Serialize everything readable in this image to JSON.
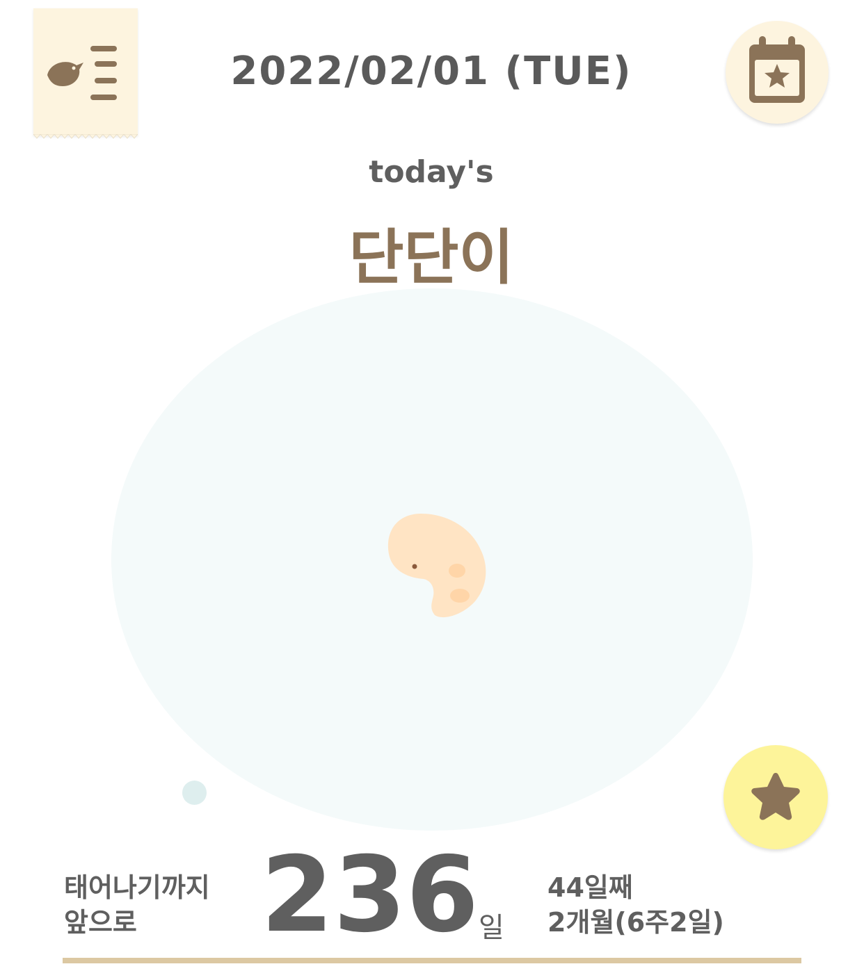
{
  "header": {
    "date": "2022/02/01 (TUE)"
  },
  "hero": {
    "todays_label": "today's",
    "baby_name": "단단이"
  },
  "countdown": {
    "label_line1": "태어나기까지",
    "label_line2": "앞으로",
    "days_left": "236",
    "unit": "일"
  },
  "pregnancy": {
    "day_count": "44일째",
    "month_week": "2개월(6주2일)"
  },
  "icons": {
    "menu": "bird-menu-icon",
    "calendar": "calendar-star-icon",
    "favorite": "star-icon",
    "illustration": "embryo-illustration"
  },
  "colors": {
    "brown_accent": "#8b7358",
    "cream": "#fdf4df",
    "yellow_button": "#fdf49a",
    "circle_bg": "#f4fafa",
    "embryo": "#ffe4c4",
    "bottom_rule": "#dcc8a2"
  }
}
